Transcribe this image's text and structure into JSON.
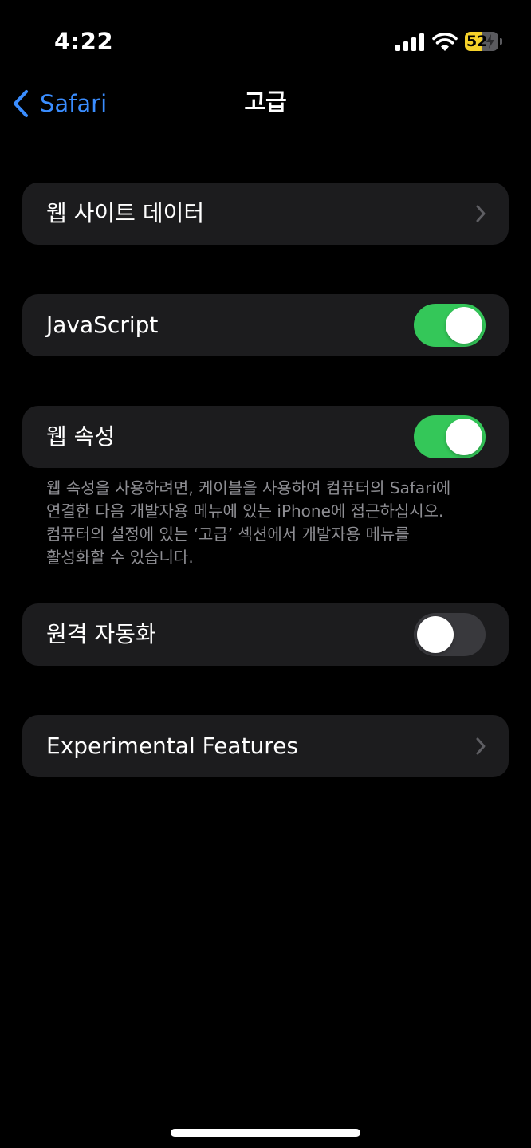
{
  "status_bar": {
    "time": "4:22",
    "battery_percent": "52",
    "battery_level": 0.52,
    "battery_color": "#f6d22a"
  },
  "nav": {
    "back_label": "Safari",
    "title": "고급"
  },
  "settings": {
    "website_data": {
      "label": "웹 사이트 데이터"
    },
    "javascript": {
      "label": "JavaScript",
      "enabled": true
    },
    "web_inspector": {
      "label": "웹 속성",
      "enabled": true,
      "footer_lines": [
        "웹 속성을 사용하려면, 케이블을 사용하여 컴퓨터의 Safari에",
        "연결한 다음 개발자용 메뉴에 있는 iPhone에 접근하십시오.",
        "컴퓨터의 설정에 있는 ‘고급’ 섹션에서 개발자용 메뉴를",
        "활성화할 수 있습니다."
      ]
    },
    "remote_automation": {
      "label": "원격 자동화",
      "enabled": false
    },
    "experimental_features": {
      "label": "Experimental Features"
    }
  },
  "colors": {
    "accent": "#3a8dff",
    "toggle_on": "#34c759",
    "toggle_off": "#39393d",
    "cell_background": "#1c1c1e",
    "footer_text": "#8e8e93"
  }
}
